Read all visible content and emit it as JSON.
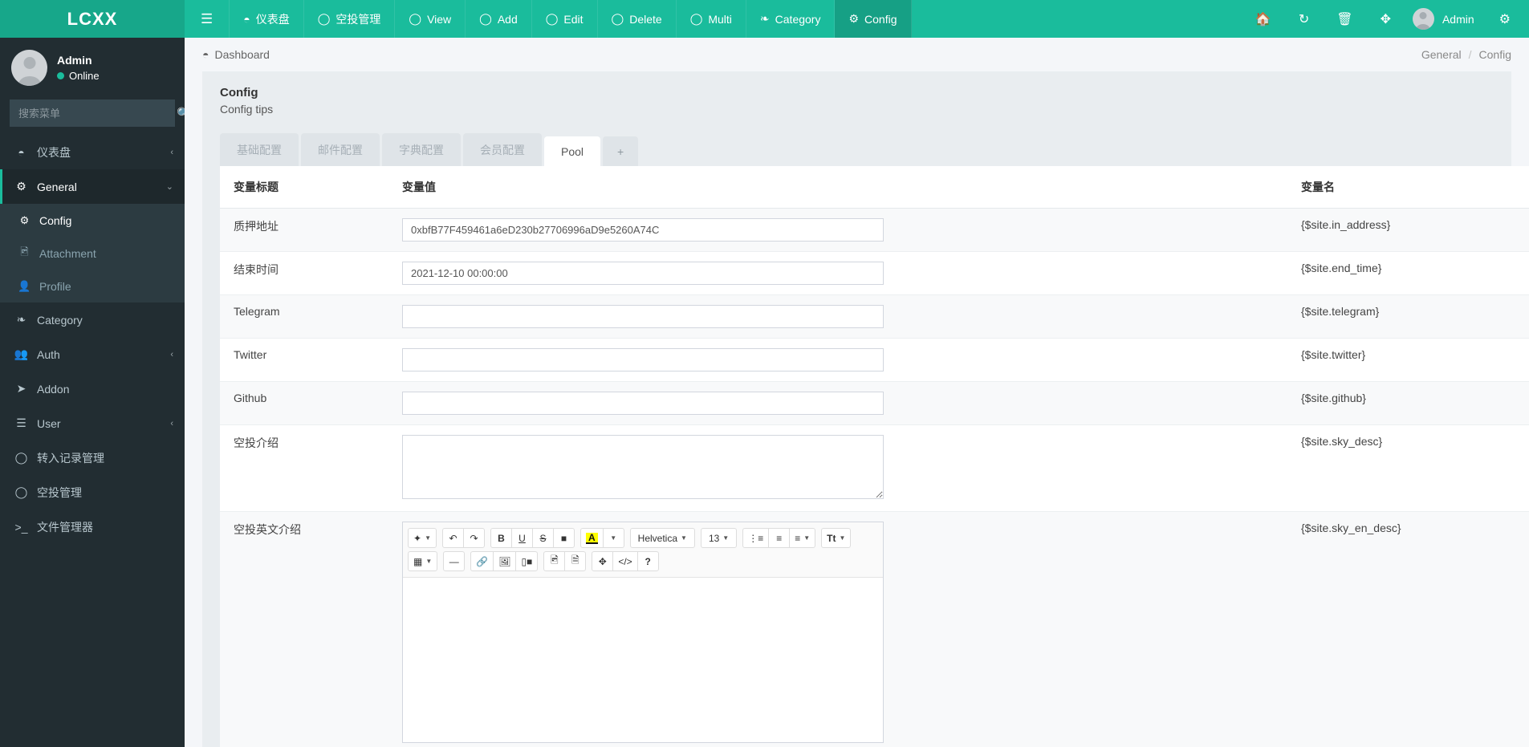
{
  "brand": {
    "name": "LCXX"
  },
  "navbar": {
    "burger_icon": "bars-icon",
    "items": [
      {
        "label": "仪表盘",
        "icon": "dashboard-icon",
        "active": false
      },
      {
        "label": "空投管理",
        "icon": "circle-icon",
        "active": false
      },
      {
        "label": "View",
        "icon": "circle-icon",
        "active": false
      },
      {
        "label": "Add",
        "icon": "circle-icon",
        "active": false
      },
      {
        "label": "Edit",
        "icon": "circle-icon",
        "active": false
      },
      {
        "label": "Delete",
        "icon": "circle-icon",
        "active": false
      },
      {
        "label": "Multi",
        "icon": "circle-icon",
        "active": false
      },
      {
        "label": "Category",
        "icon": "leaf-icon",
        "active": false
      },
      {
        "label": "Config",
        "icon": "gear-icon",
        "active": true
      }
    ],
    "right_icons": [
      "home-icon",
      "refresh-icon",
      "trash-icon",
      "expand-icon"
    ],
    "user_label": "Admin",
    "settings_icon": "gears-icon"
  },
  "sidebar": {
    "user": {
      "name": "Admin",
      "status": "Online"
    },
    "search": {
      "placeholder": "搜索菜单",
      "value": "",
      "icon": "search-icon"
    },
    "items": [
      {
        "label": "仪表盘",
        "icon": "dashboard-icon",
        "arrow": "‹",
        "state": "collapsed"
      },
      {
        "label": "General",
        "icon": "gears-icon",
        "arrow": "⌄",
        "state": "open"
      },
      {
        "label": "Category",
        "icon": "leaf-icon",
        "arrow": "",
        "state": "none"
      },
      {
        "label": "Auth",
        "icon": "users-icon",
        "arrow": "‹",
        "state": "collapsed"
      },
      {
        "label": "Addon",
        "icon": "rocket-icon",
        "arrow": "",
        "state": "none"
      },
      {
        "label": "User",
        "icon": "list-icon",
        "arrow": "‹",
        "state": "collapsed"
      },
      {
        "label": "转入记录管理",
        "icon": "circle-icon",
        "arrow": "",
        "state": "none"
      },
      {
        "label": "空投管理",
        "icon": "circle-icon",
        "arrow": "",
        "state": "none"
      },
      {
        "label": "文件管理器",
        "icon": "terminal-icon",
        "arrow": "",
        "state": "none"
      }
    ],
    "general_children": [
      {
        "label": "Config",
        "icon": "gear-icon",
        "active": true
      },
      {
        "label": "Attachment",
        "icon": "image-icon",
        "active": false
      },
      {
        "label": "Profile",
        "icon": "user-icon",
        "active": false
      }
    ]
  },
  "content_header": {
    "dashboard_label": "Dashboard",
    "dashboard_icon": "dashboard-icon",
    "breadcrumb": [
      "General",
      "Config"
    ],
    "breadcrumb_sep": "/"
  },
  "panel": {
    "title": "Config",
    "subtitle": "Config tips",
    "tabs": [
      {
        "label": "基础配置",
        "active": false
      },
      {
        "label": "邮件配置",
        "active": false
      },
      {
        "label": "字典配置",
        "active": false
      },
      {
        "label": "会员配置",
        "active": false
      },
      {
        "label": "Pool",
        "active": true
      }
    ],
    "add_tab_label": "+"
  },
  "table": {
    "headers": {
      "title": "变量标题",
      "value": "变量值",
      "name": "变量名"
    },
    "rows": [
      {
        "title": "质押地址",
        "type": "input",
        "value": "0xbfB77F459461a6eD230b27706996aD9e5260A74C",
        "name": "{$site.in_address}"
      },
      {
        "title": "结束时间",
        "type": "input",
        "value": "2021-12-10 00:00:00",
        "name": "{$site.end_time}"
      },
      {
        "title": "Telegram",
        "type": "input",
        "value": "",
        "name": "{$site.telegram}"
      },
      {
        "title": "Twitter",
        "type": "input",
        "value": "",
        "name": "{$site.twitter}"
      },
      {
        "title": "Github",
        "type": "input",
        "value": "",
        "name": "{$site.github}"
      },
      {
        "title": "空投介绍",
        "type": "textarea",
        "value": "",
        "name": "{$site.sky_desc}"
      },
      {
        "title": "空投英文介绍",
        "type": "editor",
        "value": "",
        "name": "{$site.sky_en_desc}"
      }
    ]
  },
  "editor": {
    "row1": [
      {
        "group": [
          {
            "icon": "magic-style-icon",
            "glyph": "✨",
            "caret": true
          }
        ]
      },
      {
        "group": [
          {
            "icon": "undo-icon",
            "glyph": "↶"
          },
          {
            "icon": "redo-icon",
            "glyph": "↷"
          }
        ]
      },
      {
        "group": [
          {
            "icon": "bold-icon",
            "glyph": "B"
          },
          {
            "icon": "underline-icon",
            "glyph": "U"
          },
          {
            "icon": "strikethrough-icon",
            "glyph": "S"
          },
          {
            "icon": "eraser-icon",
            "glyph": "🗑"
          }
        ]
      },
      {
        "group": [
          {
            "icon": "font-color-icon",
            "glyph": "A",
            "highlight": true
          },
          {
            "icon": "chevron-down-icon",
            "glyph": "",
            "caret": true
          }
        ]
      },
      {
        "group": [
          {
            "icon": "font-family-select",
            "glyph": "Helvetica",
            "caret": true,
            "wide": true
          }
        ]
      },
      {
        "group": [
          {
            "icon": "font-size-select",
            "glyph": "13",
            "caret": true,
            "wide": true
          }
        ]
      },
      {
        "group": [
          {
            "icon": "unordered-list-icon",
            "glyph": "☰"
          },
          {
            "icon": "ordered-list-icon",
            "glyph": "⅓"
          },
          {
            "icon": "paragraph-align-icon",
            "glyph": "≡",
            "caret": true
          }
        ]
      },
      {
        "group": [
          {
            "icon": "line-height-icon",
            "glyph": "Tt",
            "caret": true
          }
        ]
      }
    ],
    "row2": [
      {
        "group": [
          {
            "icon": "table-icon",
            "glyph": "▦",
            "caret": true
          }
        ]
      },
      {
        "group": [
          {
            "icon": "horizontal-rule-icon",
            "glyph": "—"
          }
        ]
      },
      {
        "group": [
          {
            "icon": "link-icon",
            "glyph": "🔗"
          },
          {
            "icon": "picture-icon",
            "glyph": "🖼"
          },
          {
            "icon": "video-icon",
            "glyph": "🎞"
          }
        ]
      },
      {
        "group": [
          {
            "icon": "image-upload-icon",
            "glyph": "🖻"
          },
          {
            "icon": "file-icon",
            "glyph": "🗎"
          }
        ]
      },
      {
        "group": [
          {
            "icon": "fullscreen-icon",
            "glyph": "⤢"
          },
          {
            "icon": "code-view-icon",
            "glyph": "</>"
          },
          {
            "icon": "help-icon",
            "glyph": "?"
          }
        ]
      }
    ]
  },
  "colors": {
    "brand_teal": "#1abc9c",
    "brand_teal_dark": "#16a085",
    "sidebar_bg": "#222d32",
    "sidebar_sub_bg": "#2c3b41",
    "content_bg": "#f4f6f9",
    "panel_bg": "#e9edf0"
  }
}
